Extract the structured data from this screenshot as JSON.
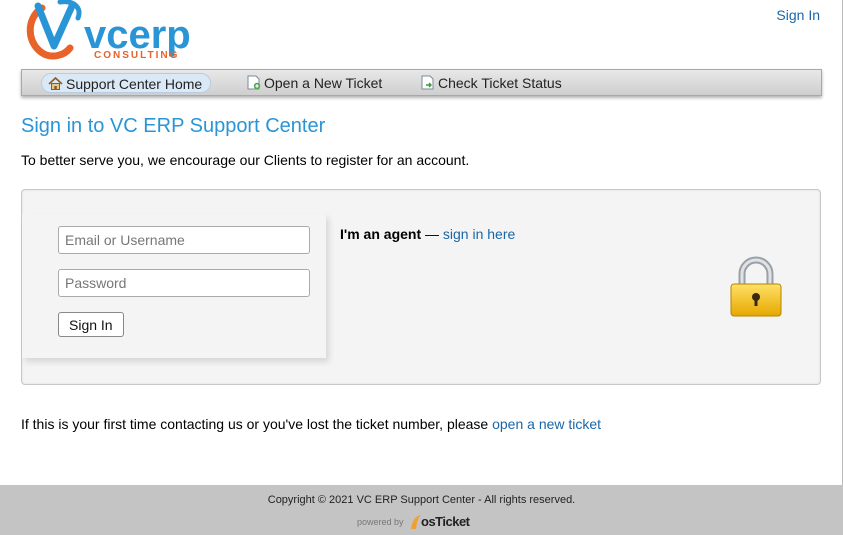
{
  "header": {
    "logo_text": "vcerp",
    "logo_subtext": "CONSULTING",
    "signin_label": "Sign In"
  },
  "nav": {
    "items": [
      {
        "label": "Support Center Home",
        "icon": "home-icon",
        "active": true
      },
      {
        "label": "Open a New Ticket",
        "icon": "new-ticket-icon",
        "active": false
      },
      {
        "label": "Check Ticket Status",
        "icon": "ticket-status-icon",
        "active": false
      }
    ]
  },
  "main": {
    "heading": "Sign in to VC ERP Support Center",
    "intro": "To better serve you, we encourage our Clients to register for an account.",
    "login": {
      "email_placeholder": "Email or Username",
      "password_placeholder": "Password",
      "submit_label": "Sign In",
      "agent_prefix": "I'm an agent",
      "agent_dash": " — ",
      "agent_link": "sign in here"
    },
    "first_time_text": "If this is your first time contacting us or you've lost the ticket number, please ",
    "first_time_link": "open a new ticket"
  },
  "footer": {
    "copyright": "Copyright © 2021 VC ERP Support Center - All rights reserved.",
    "powered_by": "powered by",
    "osticket": "osTicket"
  },
  "colors": {
    "accent": "#2a95d6",
    "link": "#1a66a8",
    "logo_blue": "#2a95d6",
    "logo_orange": "#e8622a"
  }
}
